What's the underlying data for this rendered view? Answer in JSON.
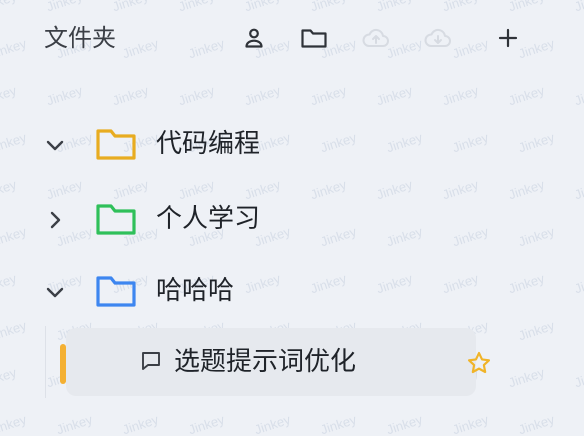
{
  "header": {
    "title": "文件夹",
    "buttons": [
      {
        "icon": "user-icon"
      },
      {
        "icon": "folder-icon"
      },
      {
        "icon": "cloud-upload-icon"
      },
      {
        "icon": "cloud-download-icon"
      },
      {
        "icon": "plus-icon"
      }
    ]
  },
  "folders": [
    {
      "label": "代码编程",
      "expanded": true,
      "color": "#e8ac20"
    },
    {
      "label": "个人学习",
      "expanded": false,
      "color": "#2fc05a"
    },
    {
      "label": "哈哈哈",
      "expanded": true,
      "color": "#3d86f0"
    }
  ],
  "conversation": {
    "label": "选题提示词优化",
    "starred": true,
    "star_color": "#f0b429",
    "accent_color": "#f4b032"
  },
  "watermark_text": "Jinkey",
  "colors": {
    "background": "#eef1f6",
    "text": "#1f2329",
    "icon": "#3b3f46"
  }
}
